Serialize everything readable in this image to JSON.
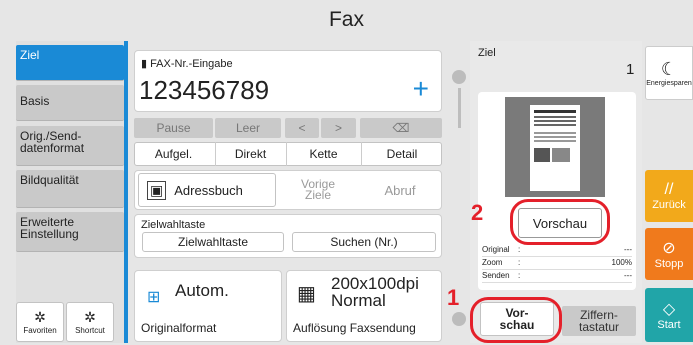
{
  "title": "Fax",
  "tabs": [
    {
      "label": "Ziel"
    },
    {
      "label": "Basis"
    },
    {
      "label": "Orig./Send-\ndatenformat"
    },
    {
      "label": "Bildqualität"
    },
    {
      "label": "Erweiterte\nEinstellung"
    }
  ],
  "fax_input": {
    "heading": "FAX-Nr.-Eingabe",
    "value": "123456789",
    "add": "+"
  },
  "row1": {
    "pause": "Pause",
    "leer": "Leer",
    "left": "<",
    "right": ">",
    "del": "⌫"
  },
  "row2": {
    "aufgel": "Aufgel.",
    "direkt": "Direkt",
    "kette": "Kette",
    "detail": "Detail"
  },
  "dest": {
    "adressbuch": "Adressbuch",
    "vorige": "Vorige\nZiele",
    "abruf": "Abruf"
  },
  "zielwahl": {
    "heading": "Zielwahltaste",
    "btn": "Zielwahltaste",
    "suchen": "Suchen (Nr.)"
  },
  "orig": {
    "value": "Autom.",
    "label": "Originalformat"
  },
  "aufl": {
    "value": "200x100dpi\nNormal",
    "label": "Auflösung Faxsendung"
  },
  "bottom_left": {
    "favoriten": "Favoriten",
    "shortcut": "Shortcut"
  },
  "preview_panel": {
    "heading": "Ziel",
    "count": "1",
    "vorschau_btn": "Vorschau",
    "info": [
      {
        "k": "Original",
        "v": "---"
      },
      {
        "k": "Zoom",
        "v": "100%"
      },
      {
        "k": "Senden",
        "v": "---"
      }
    ],
    "vor_schau": "Vor-\nschau",
    "ziffern": "Ziffern-\ntastatur"
  },
  "side": {
    "energie": "Energiesparen",
    "zurueck": "Zurück",
    "stopp": "Stopp",
    "start": "Start"
  },
  "callouts": {
    "one": "1",
    "two": "2"
  },
  "colors": {
    "accent_blue": "#1a8ad6",
    "stop": "#f07a1c",
    "zurueck": "#f2a91b",
    "start": "#21a5a8",
    "callout_red": "#e4202a"
  }
}
